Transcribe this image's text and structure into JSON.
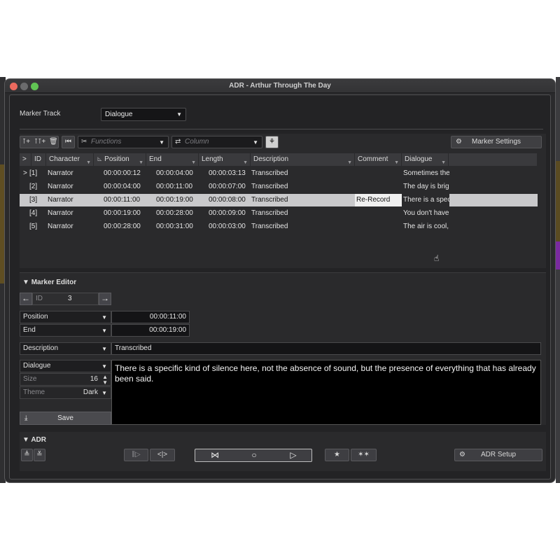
{
  "window": {
    "title": "ADR - Arthur Through The Day"
  },
  "marker_track": {
    "label": "Marker Track",
    "value": "Dialogue"
  },
  "toolbar": {
    "functions_placeholder": "Functions",
    "column_placeholder": "Column",
    "marker_settings_label": "Marker Settings"
  },
  "table": {
    "columns": [
      ">",
      "ID",
      "Character",
      "Position",
      "End",
      "Length",
      "Description",
      "Comment",
      "Dialogue"
    ],
    "rows": [
      {
        "id": "[1]",
        "character": "Narrator",
        "position": "00:00:00:12",
        "end": "00:00:04:00",
        "length": "00:00:03:13",
        "description": "Transcribed",
        "comment": "",
        "dialogue": "Sometimes the"
      },
      {
        "id": "[2]",
        "character": "Narrator",
        "position": "00:00:04:00",
        "end": "00:00:11:00",
        "length": "00:00:07:00",
        "description": "Transcribed",
        "comment": "",
        "dialogue": "The day is brigl"
      },
      {
        "id": "[3]",
        "character": "Narrator",
        "position": "00:00:11:00",
        "end": "00:00:19:00",
        "length": "00:00:08:00",
        "description": "Transcribed",
        "comment": "Re-Record",
        "dialogue": "There is a spec"
      },
      {
        "id": "[4]",
        "character": "Narrator",
        "position": "00:00:19:00",
        "end": "00:00:28:00",
        "length": "00:00:09:00",
        "description": "Transcribed",
        "comment": "",
        "dialogue": "You don't have"
      },
      {
        "id": "[5]",
        "character": "Narrator",
        "position": "00:00:28:00",
        "end": "00:00:31:00",
        "length": "00:00:03:00",
        "description": "Transcribed",
        "comment": "",
        "dialogue": "The air is cool,"
      }
    ]
  },
  "editor": {
    "title": "Marker Editor",
    "id_label": "ID",
    "id_value": "3",
    "position_label": "Position",
    "position_value": "00:00:11:00",
    "end_label": "End",
    "end_value": "00:00:19:00",
    "description_label": "Description",
    "description_value": "Transcribed",
    "text_field_label": "Dialogue",
    "size_label": "Size",
    "size_value": "16",
    "theme_label": "Theme",
    "theme_value": "Dark",
    "text": "There is a specific kind of silence here, not the absence of sound, but the presence of everything that has already been said.",
    "save_label": "Save"
  },
  "adr": {
    "title": "ADR",
    "setup_label": "ADR Setup"
  },
  "colors": {
    "window_bg": "#2a2a2c",
    "selected_row": "#c9c9cb",
    "text_area_bg": "#000000"
  }
}
